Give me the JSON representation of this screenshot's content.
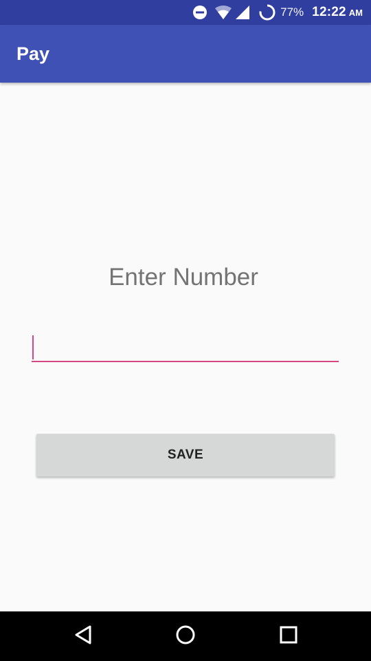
{
  "status_bar": {
    "battery_percent": "77%",
    "time": "12:22",
    "am_pm": "AM",
    "icons": [
      "do-not-disturb-icon",
      "wifi-icon",
      "cellular-signal-icon",
      "battery-charging-icon"
    ]
  },
  "app_bar": {
    "title": "Pay",
    "color": "#3f51b5"
  },
  "main": {
    "prompt": "Enter Number",
    "number_input": {
      "value": "",
      "placeholder": ""
    },
    "save_label": "SAVE"
  },
  "nav_bar": {
    "icons": [
      "back-icon",
      "home-icon",
      "recents-icon"
    ]
  },
  "colors": {
    "status_bar": "#303f9f",
    "accent": "#d6457f",
    "button": "#d6d7d7"
  }
}
